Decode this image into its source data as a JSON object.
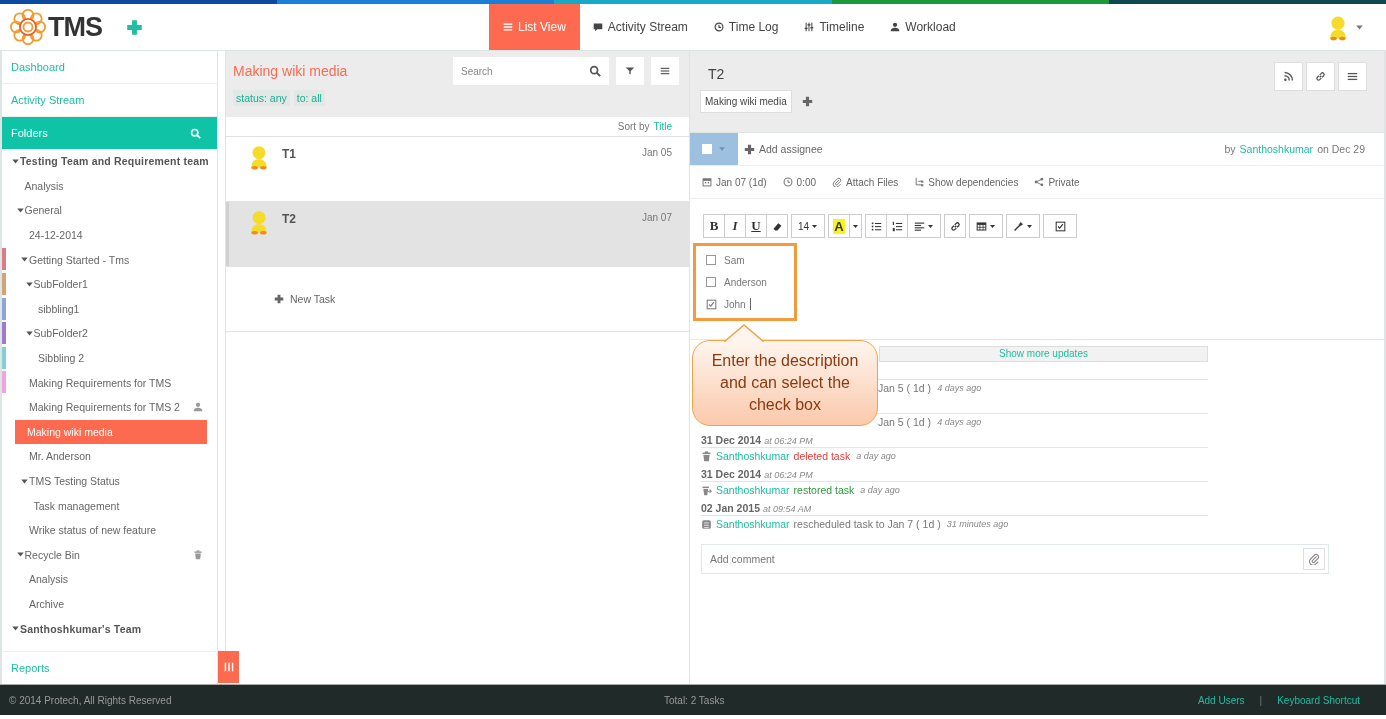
{
  "header": {
    "logo": "TMS",
    "nav": [
      {
        "label": "List View",
        "kind": "list",
        "selected": true
      },
      {
        "label": "Activity Stream",
        "kind": "chat",
        "selected": false
      },
      {
        "label": "Time Log",
        "kind": "clock",
        "selected": false
      },
      {
        "label": "Timeline",
        "kind": "sliders",
        "selected": false
      },
      {
        "label": "Workload",
        "kind": "user",
        "selected": false
      }
    ]
  },
  "sidebar": {
    "links": [
      "Dashboard",
      "Activity Stream"
    ],
    "folders_title": "Folders",
    "tree": [
      {
        "label": "Testing Team and Requirement team",
        "kind": "team",
        "expanded": true,
        "children": [
          {
            "label": "Analysis"
          },
          {
            "label": "General",
            "expanded": true,
            "children": [
              {
                "label": "24-12-2014"
              },
              {
                "label": "Getting Started - Tms",
                "expanded": true,
                "color": "#e07b86",
                "children": [
                  {
                    "label": "SubFolder1",
                    "expanded": true,
                    "color": "#d4a373",
                    "children": [
                      {
                        "label": "sibbling1",
                        "color": "#8aa7dc"
                      }
                    ]
                  },
                  {
                    "label": "SubFolder2",
                    "expanded": true,
                    "color": "#a07ad0",
                    "children": [
                      {
                        "label": "Sibbling 2",
                        "color": "#80d0d6"
                      }
                    ]
                  }
                ]
              },
              {
                "label": "Making Requirements for TMS",
                "color": "#f2a2dc"
              },
              {
                "label": "Making Requirements for TMS 2",
                "kind": "shared"
              },
              {
                "label": "Making wiki media",
                "selected": true
              },
              {
                "label": "Mr. Anderson"
              },
              {
                "label": "TMS Testing Status",
                "expanded": true,
                "children": [
                  {
                    "label": "Task management"
                  }
                ]
              },
              {
                "label": "Wrike status of new feature"
              }
            ]
          },
          {
            "label": "Recycle Bin",
            "expanded": true,
            "kind": "bin",
            "children": [
              {
                "label": "Analysis"
              },
              {
                "label": "Archive"
              }
            ]
          }
        ]
      },
      {
        "label": "Santhoshkumar's Team",
        "kind": "team",
        "expanded": true
      }
    ],
    "footer_link": "Reports"
  },
  "list": {
    "title": "Making wiki media",
    "search": {
      "placeholder": "Search"
    },
    "filters": [
      "status: any",
      "to: all"
    ],
    "sort_label": "Sort by",
    "sort_value": "Title",
    "tasks": [
      {
        "title": "T1",
        "date": "Jan 05",
        "selected": false
      },
      {
        "title": "T2",
        "date": "Jan 07",
        "selected": true
      }
    ],
    "new_task": "New Task"
  },
  "task": {
    "title": "T2",
    "done": false,
    "folder_tag": "Making wiki media",
    "assign": "Add assignee",
    "by": "by",
    "author": "Santhoshkumar",
    "on": "on Dec 29",
    "meta": [
      {
        "kind": "date",
        "label": "Jan 07 (1d)"
      },
      {
        "kind": "time",
        "label": "0:00"
      },
      {
        "kind": "attach",
        "label": "Attach Files"
      },
      {
        "kind": "deps",
        "label": "Show dependencies"
      },
      {
        "kind": "share",
        "label": "Private"
      }
    ],
    "toolbar": [
      [
        {
          "kind": "bold",
          "label": "B"
        },
        {
          "kind": "italic",
          "label": "I"
        },
        {
          "kind": "underline",
          "label": "U"
        },
        {
          "kind": "eraser"
        }
      ],
      [
        {
          "kind": "size",
          "label": "14"
        }
      ],
      [
        {
          "kind": "color",
          "label": "A"
        },
        {
          "kind": "caret"
        }
      ],
      [
        {
          "kind": "ul"
        },
        {
          "kind": "ol"
        },
        {
          "kind": "align"
        }
      ],
      [
        {
          "kind": "link"
        }
      ],
      [
        {
          "kind": "table"
        }
      ],
      [
        {
          "kind": "magic"
        }
      ],
      [
        {
          "kind": "checkbox"
        }
      ]
    ],
    "checklist": [
      {
        "label": "Sam",
        "checked": false
      },
      {
        "label": "Anderson",
        "checked": false
      },
      {
        "label": "John",
        "checked": true
      }
    ],
    "callout": "Enter the description and can select the check box",
    "show_more": "Show more updates",
    "activity": [
      {
        "kind": "covered",
        "detail": "Jan 5 ( 1d )",
        "ago": "4 days ago"
      },
      {
        "kind": "covered",
        "detail": "Jan 5 ( 1d )",
        "ago": "4 days ago"
      },
      {
        "kind": "deleted",
        "date": "31 Dec 2014",
        "time": "at 06:24 PM",
        "user": "Santhoshkumar",
        "action": "deleted task",
        "ago": "a day ago"
      },
      {
        "kind": "restored",
        "date": "31 Dec 2014",
        "time": "at 06:24 PM",
        "user": "Santhoshkumar",
        "action": "restored task",
        "ago": "a day ago"
      },
      {
        "kind": "rescheduled",
        "date": "02 Jan 2015",
        "time": "at 09:54 AM",
        "user": "Santhoshkumar",
        "action": "rescheduled task to Jan 7 ( 1d )",
        "ago": "31 minutes ago"
      }
    ],
    "comment": {
      "placeholder": "Add comment"
    }
  },
  "footer": {
    "copyright": "© 2014 Protech, All Rights Reserved",
    "total": "Total: 2 Tasks",
    "links": [
      "Add Users",
      "Keyboard Shortcut"
    ],
    "separator": "|"
  }
}
